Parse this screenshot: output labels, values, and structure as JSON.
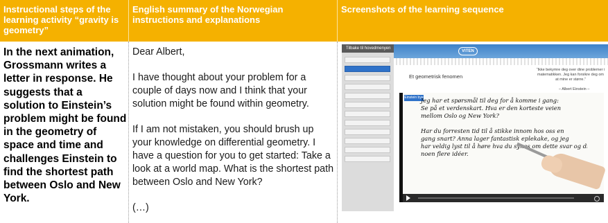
{
  "headers": {
    "col1": "Instructional steps of the learning activity “gravity is geometry”",
    "col2": "English summary of the Norwegian instructions and explanations",
    "col3": "Screenshots of the learning sequence"
  },
  "step_text": "In the next animation, Grossmann writes a letter in response. He suggests that a solution to Einstein’s problem might be found in the geometry of space and time and challenges Einstein to find the shortest path between Oslo and New York.",
  "summary": {
    "greeting": "Dear Albert,",
    "para1": "I have thought about your problem for a couple of days now and I think that your solution might be found within geometry.",
    "para2": "If I am not mistaken, you should brush up your knowledge on differential geometry. I have a question for you to get started: Take a look at a world map. What is the shortest path between Oslo and New York?",
    "ellipsis": "(…)"
  },
  "screenshot": {
    "back_link": "Tilbake til hovedmenyen",
    "logo": "VITEN",
    "exercise_title": "Et geometrisk fenomen",
    "quote": "“Ikke bekymre deg over dine problemer i matematikken. Jeg kan forsikre deg om at mine er større.”",
    "quote_author": "– Albert Einstein –",
    "badge": "Einstein bye",
    "handwriting": [
      "Jeg har et spørsmål til deg for å komme i gang:",
      "Se på et verdenskart. Hva er den korteste veien",
      "mellom Oslo og New York?",
      "Har du forresten tid til å stikke innom hos oss en",
      "gang snart? Anna lager fantastisk eplekake, og jeg",
      "har veldig lyst til å høre hva du synes om dette svar og diskutere",
      "noen flere idéer."
    ]
  },
  "colors": {
    "header_bg": "#f5b100",
    "header_text": "#ffffff",
    "sidebar_active": "#2f72c9"
  }
}
